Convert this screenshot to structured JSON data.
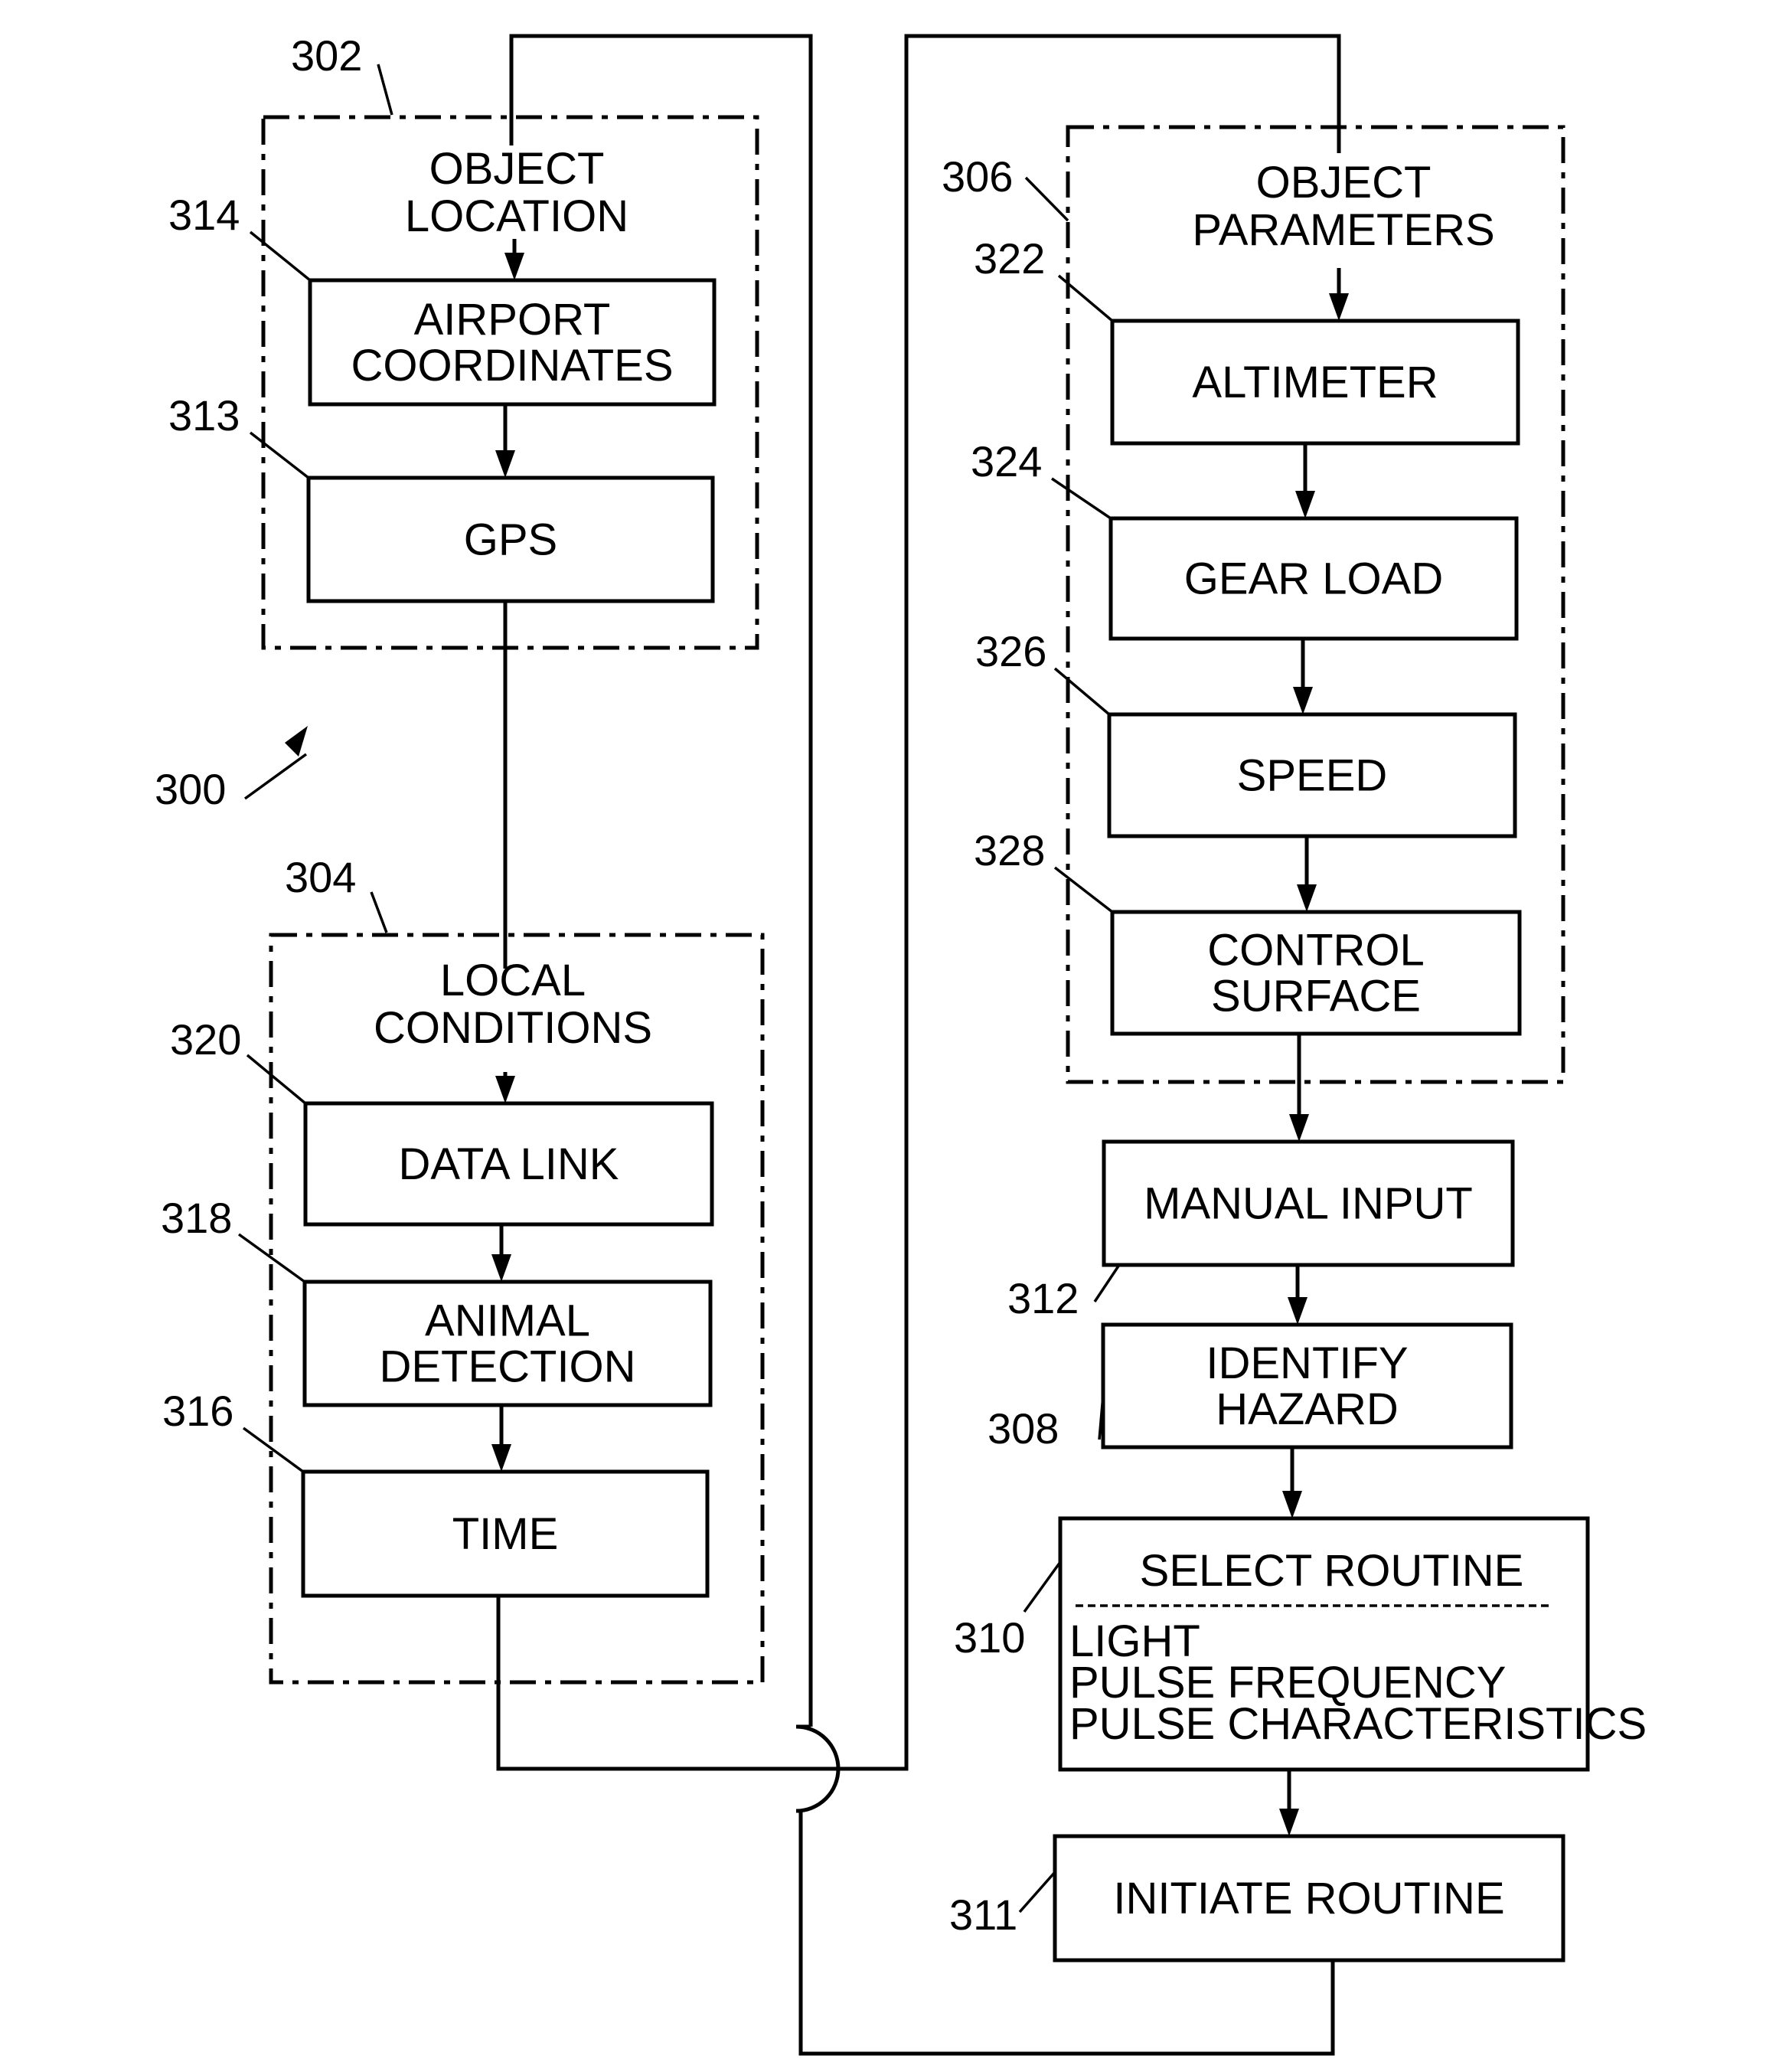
{
  "figure": {
    "ref": "300",
    "groups": [
      {
        "id": "302",
        "ref": "302",
        "title": [
          "OBJECT",
          "LOCATION"
        ]
      },
      {
        "id": "304",
        "ref": "304",
        "title": [
          "LOCAL",
          "CONDITIONS"
        ]
      },
      {
        "id": "306",
        "ref": "306",
        "title": [
          "OBJECT",
          "PARAMETERS"
        ]
      }
    ],
    "blocks": [
      {
        "id": "314",
        "ref": "314",
        "lines": [
          "AIRPORT",
          "COORDINATES"
        ]
      },
      {
        "id": "313",
        "ref": "313",
        "lines": [
          "GPS"
        ]
      },
      {
        "id": "320",
        "ref": "320",
        "lines": [
          "DATA LINK"
        ]
      },
      {
        "id": "318",
        "ref": "318",
        "lines": [
          "ANIMAL",
          "DETECTION"
        ]
      },
      {
        "id": "316",
        "ref": "316",
        "lines": [
          "TIME"
        ]
      },
      {
        "id": "322",
        "ref": "322",
        "lines": [
          "ALTIMETER"
        ]
      },
      {
        "id": "324",
        "ref": "324",
        "lines": [
          "GEAR LOAD"
        ]
      },
      {
        "id": "326",
        "ref": "326",
        "lines": [
          "SPEED"
        ]
      },
      {
        "id": "328",
        "ref": "328",
        "lines": [
          "CONTROL",
          "SURFACE"
        ]
      },
      {
        "id": "312",
        "ref": "312",
        "lines": [
          "MANUAL INPUT"
        ]
      },
      {
        "id": "308",
        "ref": "308",
        "lines": [
          "IDENTIFY",
          "HAZARD"
        ]
      },
      {
        "id": "310",
        "ref": "310",
        "lines": [
          "SELECT ROUTINE"
        ],
        "sublines": [
          "LIGHT",
          "PULSE FREQUENCY",
          "PULSE CHARACTERISTICS"
        ]
      },
      {
        "id": "311",
        "ref": "311",
        "lines": [
          "INITIATE ROUTINE"
        ]
      }
    ]
  }
}
